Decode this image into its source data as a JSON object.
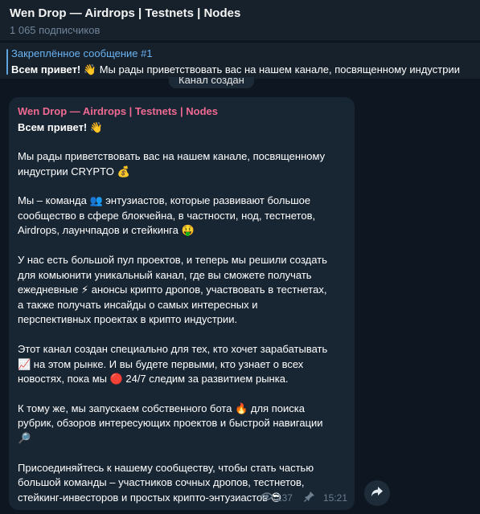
{
  "header": {
    "title": "Wen Drop — Airdrops | Testnets | Nodes",
    "subscribers": "1 065 подписчиков"
  },
  "pinned": {
    "label": "Закреплённое сообщение #1",
    "bold": "Всем привет! 👋",
    "text": " Мы рады приветствовать вас на нашем канале, посвященному индустрии"
  },
  "service_text": "Канал создан",
  "message": {
    "author": "Wen Drop — Airdrops | Testnets | Nodes",
    "greeting": "Всем привет! 👋",
    "p1_l1": "Мы рады приветствовать вас на нашем канале, посвященному",
    "p1_l2": "индустрии CRYPTO 💰",
    "p2_l1": "Мы – команда 👥 энтузиастов, которые развивают большое",
    "p2_l2": "сообщество в сфере блокчейна, в частности, нод, тестнетов,",
    "p2_l3": "Airdrops, лаунчпадов и стейкинга 🤑",
    "p3_l1": "У нас есть большой пул проектов, и теперь мы решили создать",
    "p3_l2": "для комьюнити уникальный канал, где вы сможете получать",
    "p3_l3": "ежедневные ⚡ анонсы крипто дропов, участвовать в тестнетах,",
    "p3_l4": "а также получать инсайды о самых интересных и",
    "p3_l5": "перспективных проектах в крипто индустрии.",
    "p4_l1": "Этот канал создан специально для тех, кто хочет зарабатывать",
    "p4_l2": "📈 на этом рынке. И вы будете первыми, кто узнает о всех",
    "p4_l3": "новостях, пока мы 🔴 24/7 следим за развитием рынка.",
    "p5_l1": "К тому же, мы запускаем собственного бота 🔥 для поиска",
    "p5_l2": "рубрик, обзоров интересующих проектов и быстрой навигации",
    "p5_l3": "🔎",
    "p6_l1": "Присоединяйтесь к нашему сообществу, чтобы стать частью",
    "p6_l2": "большой команды – участников сочных дропов, тестнетов,",
    "p6_l3": "стейкинг-инвесторов и простых крипто-энтузиастов 😎",
    "views": "137",
    "time": "15:21"
  },
  "icons": {
    "views": "eye-icon",
    "pin": "pin-icon",
    "share": "share-icon"
  },
  "colors": {
    "background": "#0e1621",
    "header": "#17212b",
    "bubble": "#182533",
    "author": "#f06a91",
    "pinned_label": "#6ab3f3"
  }
}
